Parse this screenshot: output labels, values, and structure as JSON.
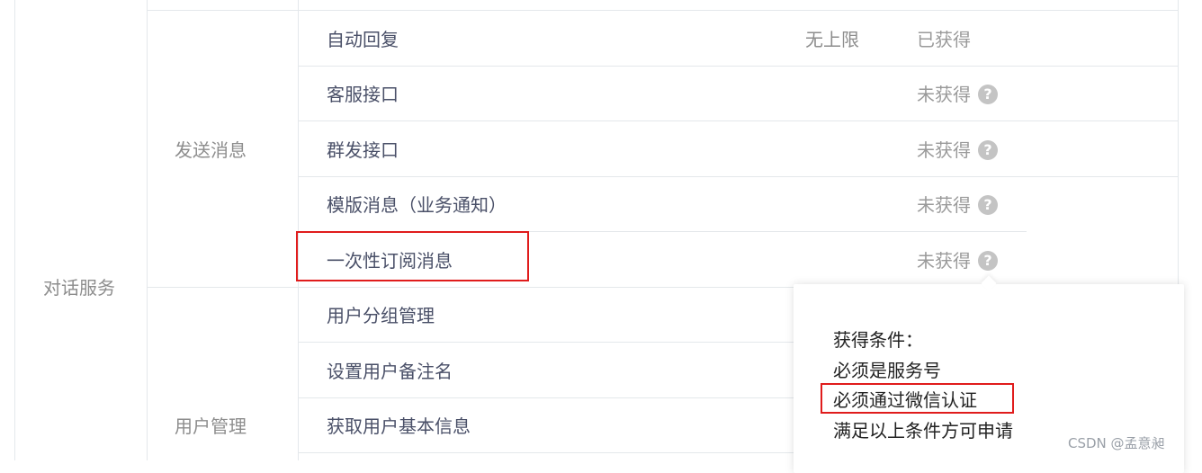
{
  "table": {
    "group_label": "对话服务",
    "categories": [
      {
        "label": "发送消息",
        "rows": [
          {
            "name": "自动回复",
            "limit": "无上限",
            "status": "已获得",
            "has_help": false
          },
          {
            "name": "客服接口",
            "limit": "",
            "status": "未获得",
            "has_help": true
          },
          {
            "name": "群发接口",
            "limit": "",
            "status": "未获得",
            "has_help": true
          },
          {
            "name": "模版消息（业务通知）",
            "limit": "",
            "status": "未获得",
            "has_help": true
          },
          {
            "name": "一次性订阅消息",
            "limit": "",
            "status": "未获得",
            "has_help": true,
            "highlighted": true
          }
        ]
      },
      {
        "label": "用户管理",
        "rows": [
          {
            "name": "用户分组管理"
          },
          {
            "name": "设置用户备注名"
          },
          {
            "name": "获取用户基本信息"
          }
        ]
      }
    ]
  },
  "tooltip": {
    "title": "获得条件：",
    "lines": [
      "必须是服务号",
      "必须通过微信认证",
      "满足以上条件方可申请"
    ],
    "highlighted_line_index": 1
  },
  "help_icon_glyph": "?",
  "watermark": "CSDN @孟意昶",
  "colors": {
    "highlight_border": "#e01c1c",
    "grid_line": "#e4e8eb",
    "help_icon": "#c4c4c4"
  }
}
